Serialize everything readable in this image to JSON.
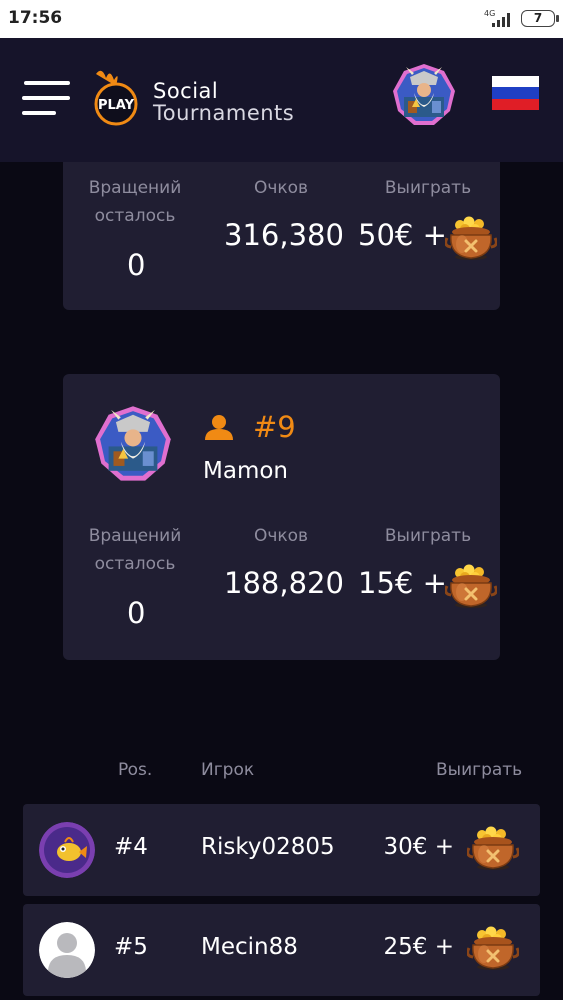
{
  "status_bar": {
    "time": "17:56",
    "network": "4G",
    "battery": "7"
  },
  "header": {
    "brand_line1": "Social",
    "brand_line2": "Tournaments",
    "logo_text": "PLAY",
    "flag": "russia-flag"
  },
  "card_top": {
    "spins_label": "Вращений осталось",
    "spins_value": "0",
    "points_label": "Очков",
    "points_value": "316,380",
    "win_label": "Выиграть",
    "win_value": "50€ +"
  },
  "card_player": {
    "rank": "#9",
    "name": "Mamon",
    "spins_label": "Вращений осталось",
    "spins_value": "0",
    "points_label": "Очков",
    "points_value": "188,820",
    "win_label": "Выиграть",
    "win_value": "15€ +"
  },
  "leaderboard": {
    "headers": {
      "pos": "Pos.",
      "player": "Игрок",
      "win": "Выиграть"
    },
    "rows": [
      {
        "pos": "#4",
        "name": "Risky02805",
        "prize": "30€ +"
      },
      {
        "pos": "#5",
        "name": "Mecin88",
        "prize": "25€ +"
      }
    ]
  },
  "colors": {
    "accent": "#f08a14",
    "card_bg": "#201e32",
    "header_bg": "#16142a",
    "page_bg": "#0a0914",
    "muted_text": "#8e8c9e"
  }
}
